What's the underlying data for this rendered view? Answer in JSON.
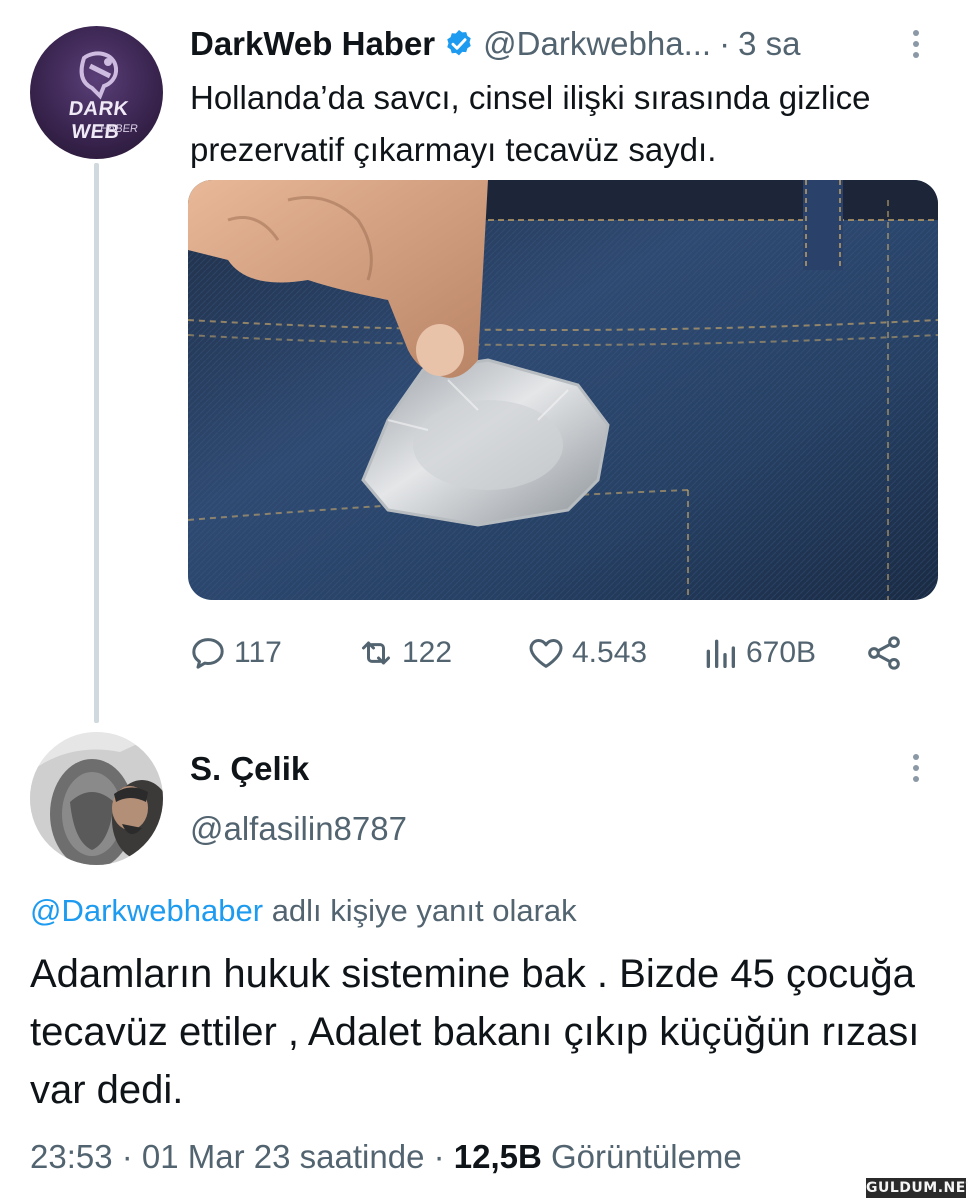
{
  "tweet1": {
    "author_name": "DarkWeb Haber",
    "handle": "@Darkwebha...",
    "separator": "·",
    "time": "3 sa",
    "text": "Hollanda’da savcı, cinsel ilişki sırasında gizlice prezervatif çıkarmayı tecavüz saydı.",
    "avatar_logo": {
      "line1": "DARK WEB",
      "line2": "HABER"
    },
    "image_icon": "condom-packet-jeans-photo",
    "actions": {
      "replies": "117",
      "retweets": "122",
      "likes": "4.543",
      "views": "670B"
    }
  },
  "tweet2": {
    "author_name": "S. Çelik",
    "handle": "@alfasilin8787",
    "reply_to_mention": "@Darkwebhaber",
    "reply_to_suffix": " adlı kişiye yanıt olarak",
    "text": "Adamların hukuk sistemine bak . Bizde 45 çocuğa tecavüz ettiler , Adalet bakanı çıkıp küçüğün rızası var dedi.",
    "time": "23:53",
    "date": "01 Mar 23 saatinde",
    "sep1": " · ",
    "sep2": " · ",
    "views_count": "12,5B",
    "views_label": " Görüntüleme"
  },
  "watermark": "GULDUM.NET",
  "colors": {
    "text_primary": "#0f1419",
    "text_secondary": "#536471",
    "accent": "#1d9bf0",
    "thread_line": "#cfd9de"
  }
}
